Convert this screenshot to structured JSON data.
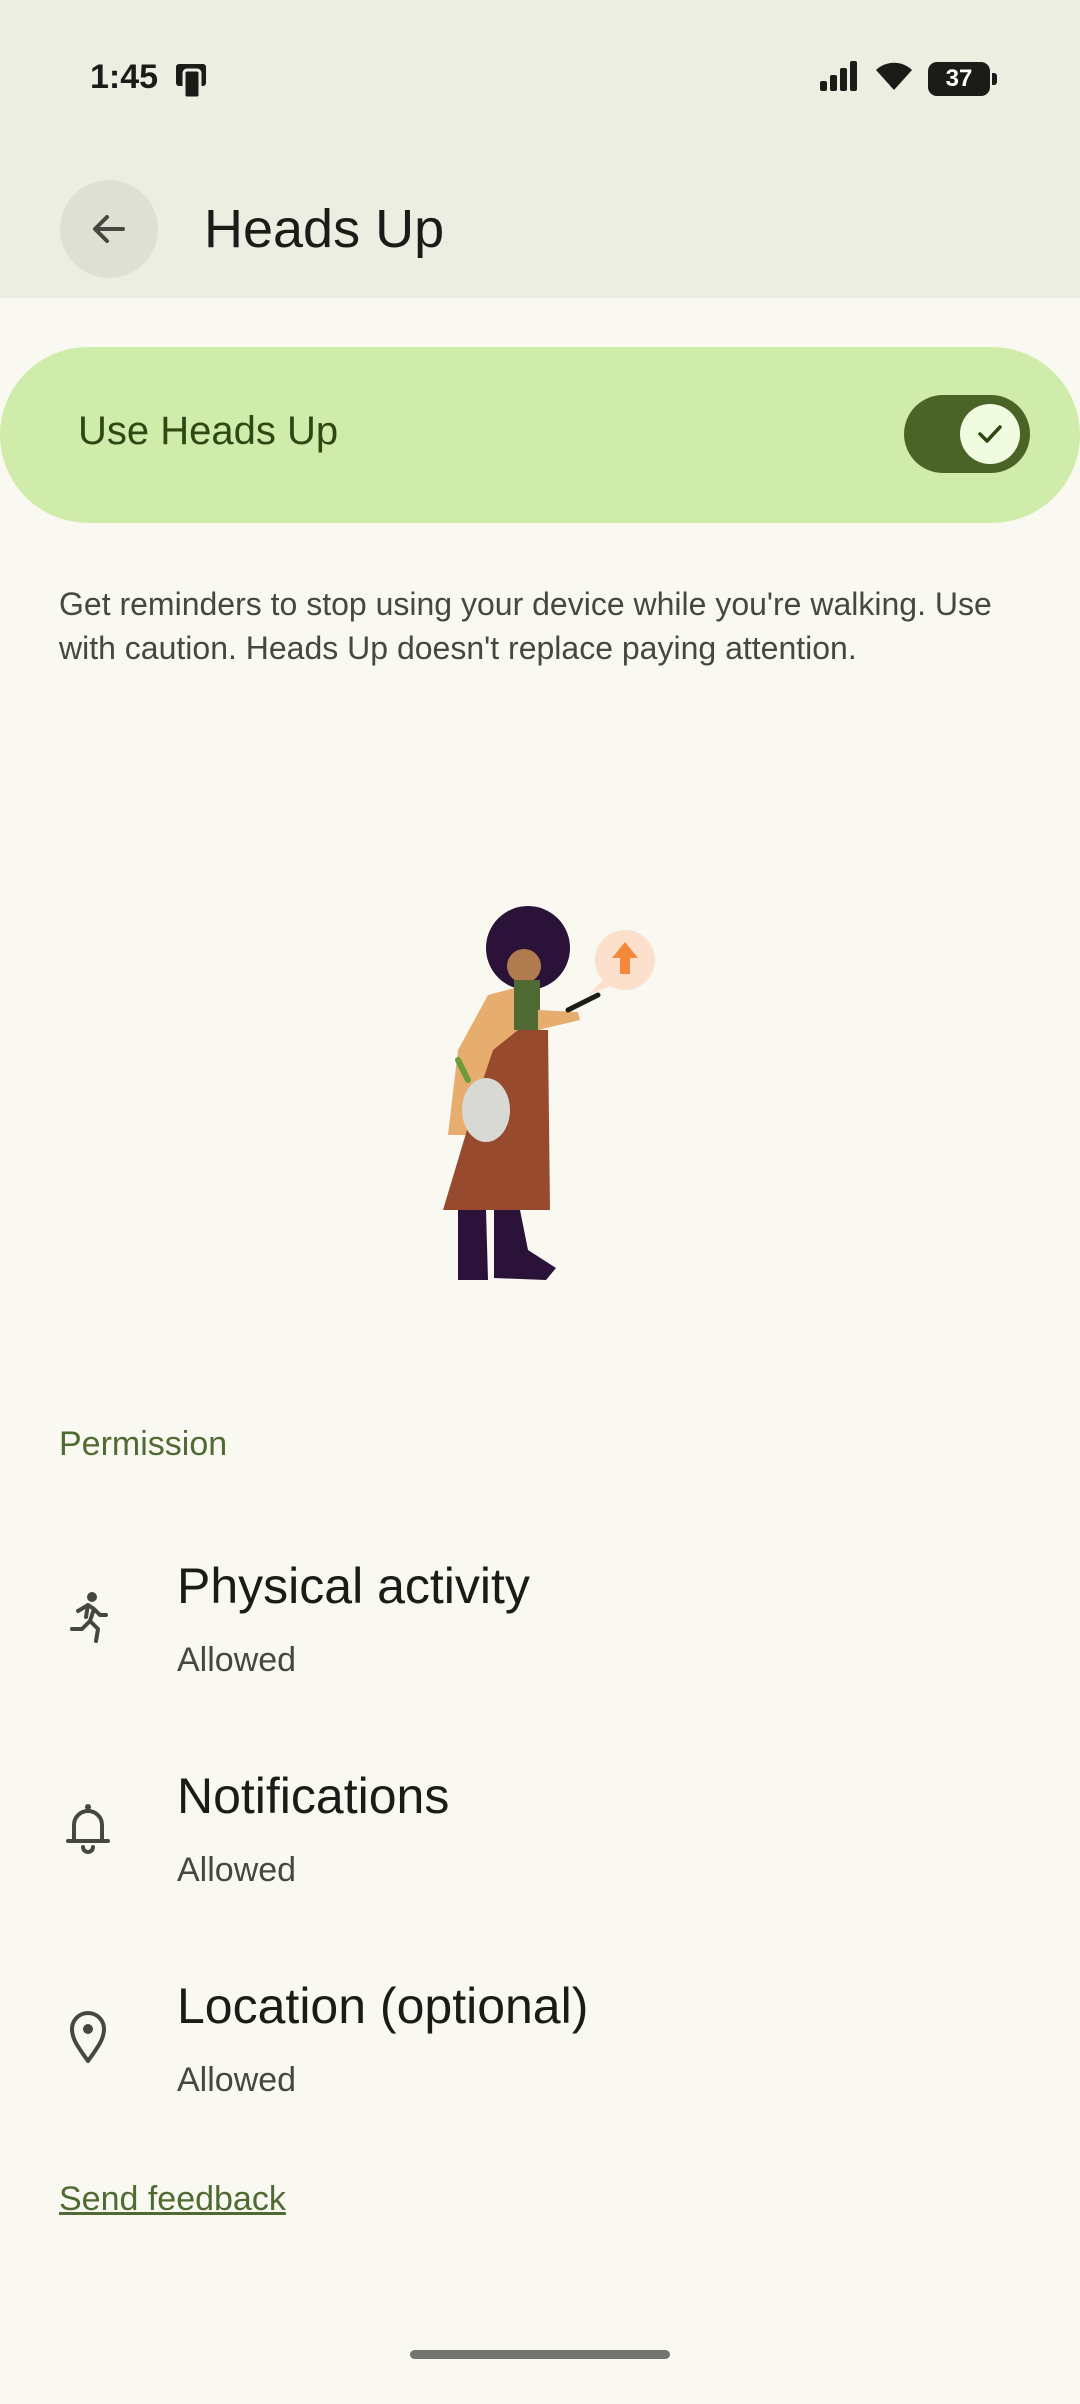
{
  "status_bar": {
    "time": "1:45",
    "battery_level": "37"
  },
  "app_bar": {
    "title": "Heads Up"
  },
  "main_toggle": {
    "label": "Use Heads Up",
    "checked": true
  },
  "description": "Get reminders to stop using your device while you're walking. Use with caution. Heads Up doesn't replace paying attention.",
  "permission": {
    "header": "Permission",
    "items": [
      {
        "title": "Physical activity",
        "status": "Allowed",
        "icon": "running-person-icon"
      },
      {
        "title": "Notifications",
        "status": "Allowed",
        "icon": "bell-icon"
      },
      {
        "title": "Location (optional)",
        "status": "Allowed",
        "icon": "location-pin-icon"
      }
    ]
  },
  "feedback": {
    "label": "Send feedback"
  },
  "colors": {
    "accent": "#4a6327",
    "toggle_bg": "#d0ecaa",
    "background": "#f9f9f1"
  }
}
